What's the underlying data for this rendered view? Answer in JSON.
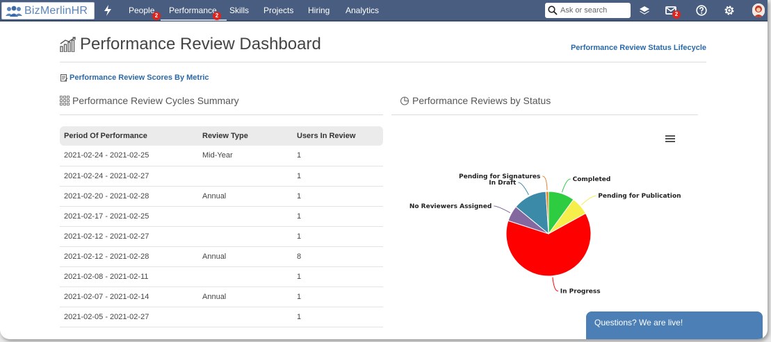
{
  "app": {
    "logo_text": "BizMerlinHR",
    "nav": [
      {
        "label": "People",
        "badge": "2"
      },
      {
        "label": "Performance",
        "badge": "2"
      },
      {
        "label": "Skills"
      },
      {
        "label": "Projects"
      },
      {
        "label": "Hiring"
      },
      {
        "label": "Analytics"
      }
    ],
    "search_placeholder": "Ask or search",
    "mail_badge": "2"
  },
  "page": {
    "title": "Performance Review Dashboard",
    "lifecycle_link": "Performance Review Status Lifecycle",
    "metric_link": "Performance Review Scores By Metric"
  },
  "cycles": {
    "heading": "Performance Review Cycles Summary",
    "columns": [
      "Period Of Performance",
      "Review Type",
      "Users In Review"
    ],
    "rows": [
      [
        "2021-02-24 - 2021-02-25",
        "Mid-Year",
        "1"
      ],
      [
        "2021-02-24 - 2021-02-27",
        "",
        "1"
      ],
      [
        "2021-02-20 - 2021-02-28",
        "Annual",
        "1"
      ],
      [
        "2021-02-17 - 2021-02-25",
        "",
        "1"
      ],
      [
        "2021-02-12 - 2021-02-27",
        "",
        "1"
      ],
      [
        "2021-02-12 - 2021-02-28",
        "Annual",
        "8"
      ],
      [
        "2021-02-08 - 2021-02-11",
        "",
        "1"
      ],
      [
        "2021-02-07 - 2021-02-14",
        "Annual",
        "1"
      ],
      [
        "2021-02-05 - 2021-02-27",
        "",
        "1"
      ]
    ]
  },
  "status_chart": {
    "heading": "Performance Reviews by Status"
  },
  "chart_data": {
    "type": "pie",
    "title": "",
    "categories": [
      "Completed",
      "Pending for Publication",
      "In Progress",
      "No Reviewers Assigned",
      "In Draft",
      "Pending for Signatures"
    ],
    "values": [
      10,
      7,
      63,
      6,
      13,
      1
    ],
    "colors": [
      "#2ecc40",
      "#f6ee4a",
      "#ff0000",
      "#8468a0",
      "#3a8aa8",
      "#e87e24"
    ],
    "legend": "none"
  },
  "chat": {
    "label": "Questions? We are live!"
  }
}
